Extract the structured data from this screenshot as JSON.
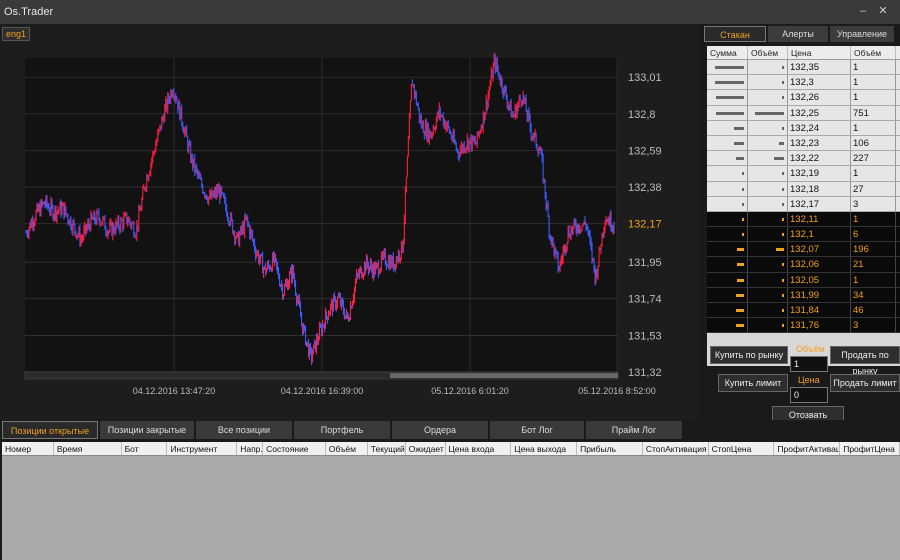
{
  "window": {
    "title": "Os.Trader"
  },
  "chart": {
    "tab_label": "eng1",
    "price_ticks": [
      "133,01",
      "132,8",
      "132,59",
      "132,38",
      "132,17",
      "131,95",
      "131,74",
      "131,53",
      "131,32"
    ],
    "current_price": "132,17",
    "time_labels": [
      "04.12.2016 13:47:20",
      "04.12.2016 16:39:00",
      "05.12.2016 6:01:20",
      "05.12.2016 8:52:00"
    ],
    "colors": {
      "up": "#ff1e3c",
      "down": "#3a5cff",
      "current": "#f0a020",
      "grid": "#3a3a3a"
    },
    "chart_data": {
      "type": "line",
      "ylim": [
        131.32,
        133.12
      ],
      "series": [
        {
          "values": [
            132.12,
            132.22,
            132.29,
            132.24,
            132.26,
            132.17,
            132.08,
            132.18,
            132.21,
            132.13,
            132.16,
            132.2,
            132.13,
            132.41,
            132.6,
            132.8,
            132.96,
            132.76,
            132.54,
            132.4,
            132.31,
            132.36,
            132.23,
            132.07,
            132.19,
            132.02,
            131.9,
            131.96,
            131.78,
            131.9,
            131.6,
            131.4,
            131.55,
            131.68,
            131.74,
            131.62,
            131.86,
            131.94,
            131.9,
            131.97,
            131.94,
            132.04,
            133.0,
            132.74,
            132.68,
            132.81,
            132.71,
            132.58,
            132.64,
            132.63,
            132.83,
            133.1,
            132.94,
            132.78,
            132.91,
            132.7,
            132.58,
            132.12,
            131.91,
            132.12,
            132.16,
            132.17,
            131.86,
            132.21,
            132.17
          ]
        }
      ]
    }
  },
  "right_panel": {
    "tabs": [
      "Стакан",
      "Алерты",
      "Управление"
    ],
    "book_headers": [
      "Сумма",
      "Объём",
      "Цена",
      "Объём"
    ],
    "asks": [
      {
        "price": "132,35",
        "qty": "1",
        "sum_bar": 0.85,
        "vol_bar": 0
      },
      {
        "price": "132,3",
        "qty": "1",
        "sum_bar": 0.85,
        "vol_bar": 0
      },
      {
        "price": "132,26",
        "qty": "1",
        "sum_bar": 0.82,
        "vol_bar": 0
      },
      {
        "price": "132,25",
        "qty": "751",
        "sum_bar": 0.82,
        "vol_bar": 0.85
      },
      {
        "price": "132,24",
        "qty": "1",
        "sum_bar": 0.3,
        "vol_bar": 0
      },
      {
        "price": "132,23",
        "qty": "106",
        "sum_bar": 0.3,
        "vol_bar": 0.15
      },
      {
        "price": "132,22",
        "qty": "227",
        "sum_bar": 0.25,
        "vol_bar": 0.3
      },
      {
        "price": "132,19",
        "qty": "1",
        "sum_bar": 0.05,
        "vol_bar": 0
      },
      {
        "price": "132,18",
        "qty": "27",
        "sum_bar": 0.05,
        "vol_bar": 0
      },
      {
        "price": "132,17",
        "qty": "3",
        "sum_bar": 0.05,
        "vol_bar": 0
      }
    ],
    "bids": [
      {
        "price": "132,11",
        "qty": "1",
        "sum_bar": 0,
        "vol_bar": 0
      },
      {
        "price": "132,1",
        "qty": "6",
        "sum_bar": 0,
        "vol_bar": 0
      },
      {
        "price": "132,07",
        "qty": "196",
        "sum_bar": 0.2,
        "vol_bar": 0.25
      },
      {
        "price": "132,06",
        "qty": "21",
        "sum_bar": 0.2,
        "vol_bar": 0
      },
      {
        "price": "132,05",
        "qty": "1",
        "sum_bar": 0.2,
        "vol_bar": 0
      },
      {
        "price": "131,99",
        "qty": "34",
        "sum_bar": 0.25,
        "vol_bar": 0
      },
      {
        "price": "131,84",
        "qty": "46",
        "sum_bar": 0.25,
        "vol_bar": 0
      },
      {
        "price": "131,76",
        "qty": "3",
        "sum_bar": 0.25,
        "vol_bar": 0
      }
    ],
    "buy_market": "Купить по рынку",
    "sell_market": "Продать по рынку",
    "volume_label": "Объём",
    "volume_value": "1",
    "buy_limit": "Купить лимит",
    "sell_limit": "Продать лимит",
    "price_label": "Цена",
    "price_value": "0",
    "cancel_limits": "Отозвать лимиты"
  },
  "bottom_tabs": [
    "Позиции открытые",
    "Позиции закрытые",
    "Все позиции",
    "Портфель",
    "Ордера",
    "Бот Лог",
    "Прайм Лог"
  ],
  "positions_table": {
    "headers": [
      "Номер",
      "Время",
      "Бот",
      "Инструмент",
      "Напр.",
      "Состояние",
      "Объём",
      "Текущий",
      "Ожидает",
      "Цена входа",
      "Цена выхода",
      "Прибыль",
      "СтопАктивация",
      "СтопЦена",
      "ПрофитАктивац",
      "ПрофитЦена"
    ]
  }
}
